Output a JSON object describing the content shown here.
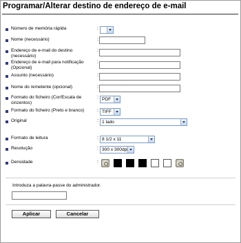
{
  "page_title": "Programar/Alterar destino de endereço de e-mail",
  "fields": {
    "speed_dial": {
      "label": "Número de memória rápida",
      "value": ""
    },
    "name": {
      "label": "Nome (necessário)",
      "value": ""
    },
    "dest_email": {
      "label": "Endereço de e-mail do destino (necessário)",
      "value": ""
    },
    "notify_email": {
      "label": "Endereço de e-mail para notificação (Opcional)",
      "value": ""
    },
    "subject": {
      "label": "Assunto (necessário)",
      "value": ""
    },
    "sender_name": {
      "label": "Nome do remetente (opcional)",
      "value": ""
    },
    "file_format_color": {
      "label": "Formato do ficheiro (Cor/Escala de cinzentos)",
      "value": "PDF"
    },
    "file_format_bw": {
      "label": "Formato do ficheiro (Preto e branco)",
      "value": "TIFF"
    },
    "original": {
      "label": "Original",
      "value": "1 lado"
    },
    "scan_format": {
      "label": "Formato de leitura",
      "value": "8 1/2 x 11"
    },
    "resolution": {
      "label": "Resolução",
      "value": "300 x 300dpi"
    },
    "density": {
      "label": "Densidade",
      "level": 3,
      "levels": 5
    }
  },
  "admin": {
    "prompt": "Introduza a palavra-passe do administrador.",
    "password": ""
  },
  "buttons": {
    "apply": "Aplicar",
    "cancel": "Cancelar"
  },
  "colon": ":"
}
